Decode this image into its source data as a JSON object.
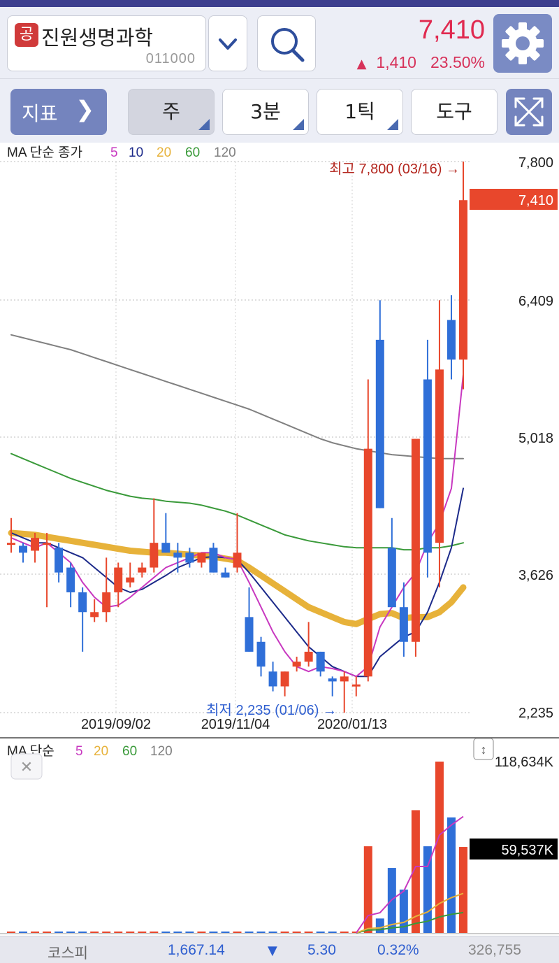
{
  "header": {
    "badge": "공",
    "stock_name": "진원생명과학",
    "stock_code": "011000",
    "price": "7,410",
    "change_arrow": "▲",
    "change_value": "1,410",
    "change_pct": "23.50%"
  },
  "toolbar": {
    "indicator_label": "지표",
    "indicator_chevron": "❯",
    "period_label": "주",
    "minute_label": "3분",
    "tick_label": "1틱",
    "tools_label": "도구"
  },
  "price_panel": {
    "ma_prefix": "MA 단순 종가",
    "ma_periods": [
      "5",
      "10",
      "20",
      "60",
      "120"
    ],
    "y_ticks": [
      "7,800",
      "6,409",
      "5,018",
      "3,626",
      "2,235"
    ],
    "current_tag": "7,410",
    "high_annotation": "최고 7,800 (03/16) →",
    "low_annotation": "최저 2,235 (01/06) →",
    "x_labels": [
      "2019/09/02",
      "2019/11/04",
      "2020/01/13"
    ]
  },
  "volume_panel": {
    "ma_prefix": "MA 단순",
    "ma_periods": [
      "5",
      "20",
      "60",
      "120"
    ],
    "max_label": "118,634K",
    "current_tag": "59,537K",
    "close_symbol": "✕",
    "resize_symbol": "↕"
  },
  "footer": {
    "index_name": "코스피",
    "index_value": "1,667.14",
    "arrow": "▼",
    "change": "5.30",
    "pct": "0.32%",
    "volume": "326,755"
  },
  "colors": {
    "up": "#e8472c",
    "down": "#2f6fd8",
    "ma5": "#c838c0",
    "ma10": "#1c2a8a",
    "ma20": "#e7b23a",
    "ma60": "#3a9a3a",
    "ma120": "#808080",
    "accent": "#7484be"
  },
  "chart_data": {
    "type": "candlestick",
    "y_axis": [
      2235,
      7800
    ],
    "volume_axis_max_k": 118634,
    "x_ticks": [
      "2019/09/02",
      "2019/11/04",
      "2020/01/13"
    ],
    "candles": [
      {
        "o": 3950,
        "h": 4200,
        "l": 3850,
        "c": 3950
      },
      {
        "o": 3920,
        "h": 3950,
        "l": 3750,
        "c": 3850
      },
      {
        "o": 3870,
        "h": 4050,
        "l": 3750,
        "c": 4000
      },
      {
        "o": 3950,
        "h": 4050,
        "l": 3300,
        "c": 3950
      },
      {
        "o": 3900,
        "h": 3950,
        "l": 3550,
        "c": 3650
      },
      {
        "o": 3700,
        "h": 3750,
        "l": 3300,
        "c": 3450
      },
      {
        "o": 3450,
        "h": 3500,
        "l": 2850,
        "c": 3250
      },
      {
        "o": 3200,
        "h": 3380,
        "l": 3150,
        "c": 3250
      },
      {
        "o": 3250,
        "h": 3800,
        "l": 3150,
        "c": 3450
      },
      {
        "o": 3450,
        "h": 3750,
        "l": 3300,
        "c": 3700
      },
      {
        "o": 3550,
        "h": 3750,
        "l": 3500,
        "c": 3600
      },
      {
        "o": 3650,
        "h": 3750,
        "l": 3600,
        "c": 3700
      },
      {
        "o": 3700,
        "h": 4400,
        "l": 3650,
        "c": 3950
      },
      {
        "o": 3950,
        "h": 4250,
        "l": 3850,
        "c": 3850
      },
      {
        "o": 3850,
        "h": 3950,
        "l": 3650,
        "c": 3800
      },
      {
        "o": 3850,
        "h": 3900,
        "l": 3700,
        "c": 3750
      },
      {
        "o": 3750,
        "h": 3850,
        "l": 3700,
        "c": 3850
      },
      {
        "o": 3900,
        "h": 3950,
        "l": 3650,
        "c": 3650
      },
      {
        "o": 3650,
        "h": 3700,
        "l": 3600,
        "c": 3600
      },
      {
        "o": 3700,
        "h": 4250,
        "l": 3650,
        "c": 3850
      },
      {
        "o": 3200,
        "h": 3500,
        "l": 2850,
        "c": 2850
      },
      {
        "o": 2950,
        "h": 3000,
        "l": 2600,
        "c": 2700
      },
      {
        "o": 2650,
        "h": 2750,
        "l": 2450,
        "c": 2500
      },
      {
        "o": 2500,
        "h": 2650,
        "l": 2400,
        "c": 2650
      },
      {
        "o": 2700,
        "h": 2800,
        "l": 2650,
        "c": 2750
      },
      {
        "o": 2750,
        "h": 3150,
        "l": 2700,
        "c": 2850
      },
      {
        "o": 2850,
        "h": 2850,
        "l": 2600,
        "c": 2650
      },
      {
        "o": 2580,
        "h": 2600,
        "l": 2400,
        "c": 2550
      },
      {
        "o": 2550,
        "h": 2650,
        "l": 2235,
        "c": 2600
      },
      {
        "o": 2520,
        "h": 2600,
        "l": 2400,
        "c": 2520
      },
      {
        "o": 2600,
        "h": 5600,
        "l": 2550,
        "c": 4900
      },
      {
        "o": 6000,
        "h": 6400,
        "l": 4300,
        "c": 4300
      },
      {
        "o": 3900,
        "h": 4200,
        "l": 3350,
        "c": 3300
      },
      {
        "o": 3300,
        "h": 3550,
        "l": 2800,
        "c": 2950
      },
      {
        "o": 2950,
        "h": 5000,
        "l": 2800,
        "c": 5000
      },
      {
        "o": 5600,
        "h": 6000,
        "l": 3600,
        "c": 3850
      },
      {
        "o": 3950,
        "h": 6400,
        "l": 3500,
        "c": 5700
      },
      {
        "o": 6200,
        "h": 6450,
        "l": 5600,
        "c": 5800
      },
      {
        "o": 5800,
        "h": 7800,
        "l": 5500,
        "c": 7410
      }
    ],
    "ma_series": [
      {
        "name": "5",
        "values": [
          4000,
          3950,
          3900,
          3950,
          3850,
          3750,
          3550,
          3400,
          3300,
          3320,
          3400,
          3500,
          3600,
          3700,
          3750,
          3800,
          3850,
          3850,
          3800,
          3780,
          3550,
          3300,
          3050,
          2850,
          2700,
          2650,
          2700,
          2680,
          2650,
          2600,
          2700,
          3100,
          3300,
          3500,
          3650,
          3950,
          4150,
          4500,
          5650
        ]
      },
      {
        "name": "10",
        "values": [
          4050,
          4000,
          3950,
          3950,
          3900,
          3850,
          3800,
          3700,
          3600,
          3500,
          3450,
          3480,
          3550,
          3620,
          3700,
          3750,
          3800,
          3810,
          3800,
          3780,
          3650,
          3500,
          3350,
          3200,
          3050,
          2900,
          2800,
          2700,
          2650,
          2600,
          2600,
          2800,
          2900,
          3000,
          3050,
          3250,
          3550,
          3900,
          4500
        ]
      },
      {
        "name": "20",
        "values": [
          4050,
          4040,
          4030,
          4010,
          3990,
          3970,
          3950,
          3930,
          3910,
          3890,
          3870,
          3860,
          3850,
          3850,
          3840,
          3830,
          3820,
          3810,
          3790,
          3770,
          3700,
          3620,
          3540,
          3460,
          3380,
          3300,
          3250,
          3200,
          3150,
          3130,
          3180,
          3230,
          3240,
          3190,
          3200,
          3200,
          3250,
          3350,
          3500
        ]
      },
      {
        "name": "60",
        "values": [
          4850,
          4800,
          4750,
          4700,
          4650,
          4600,
          4560,
          4520,
          4480,
          4450,
          4420,
          4400,
          4390,
          4370,
          4360,
          4350,
          4330,
          4300,
          4270,
          4230,
          4180,
          4130,
          4080,
          4030,
          4000,
          3970,
          3950,
          3930,
          3910,
          3900,
          3900,
          3900,
          3900,
          3880,
          3880,
          3900,
          3900,
          3920,
          3950
        ]
      },
      {
        "name": "120",
        "values": [
          6050,
          6020,
          5990,
          5960,
          5930,
          5900,
          5860,
          5820,
          5780,
          5740,
          5700,
          5660,
          5620,
          5580,
          5540,
          5500,
          5460,
          5420,
          5380,
          5340,
          5300,
          5250,
          5200,
          5150,
          5100,
          5050,
          5000,
          4960,
          4930,
          4900,
          4880,
          4860,
          4840,
          4830,
          4820,
          4810,
          4800,
          4800,
          4800
        ]
      }
    ],
    "volume_k": [
      0,
      0,
      0,
      0,
      0,
      0,
      0,
      0,
      0,
      0,
      0,
      0,
      0,
      0,
      800,
      0,
      0,
      0,
      0,
      0,
      0,
      0,
      0,
      0,
      0,
      0,
      0,
      0,
      0,
      0,
      60000,
      10000,
      45000,
      30000,
      85000,
      60000,
      118634,
      80000,
      59537
    ]
  }
}
